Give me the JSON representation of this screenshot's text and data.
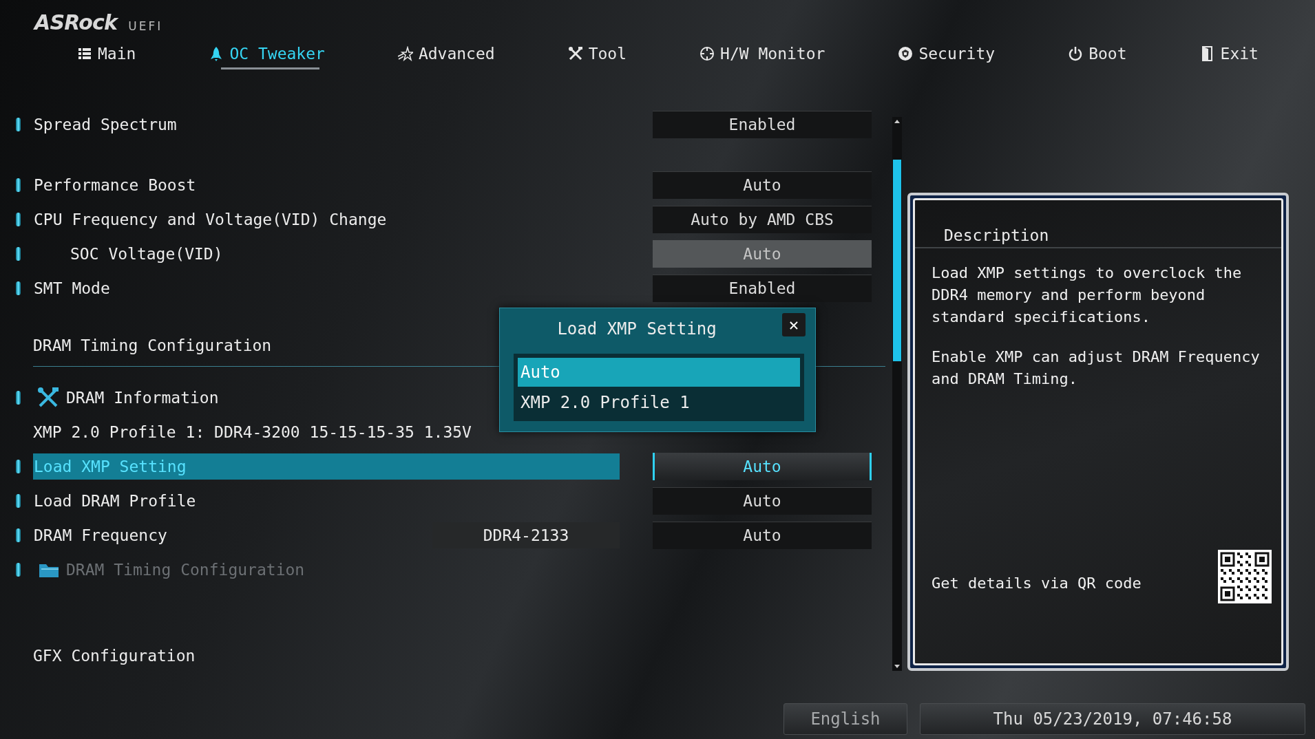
{
  "header": {
    "logo": "ASRock",
    "subtitle": "UEFI"
  },
  "tabs": [
    {
      "label": "Main",
      "selected": false
    },
    {
      "label": "OC Tweaker",
      "selected": true
    },
    {
      "label": "Advanced",
      "selected": false
    },
    {
      "label": "Tool",
      "selected": false
    },
    {
      "label": "H/W Monitor",
      "selected": false
    },
    {
      "label": "Security",
      "selected": false
    },
    {
      "label": "Boot",
      "selected": false
    },
    {
      "label": "Exit",
      "selected": false
    }
  ],
  "settings": [
    {
      "kind": "setting",
      "label": "Spread Spectrum",
      "value": "Enabled",
      "selected": false,
      "disabled": false
    },
    {
      "kind": "setting",
      "label": "Performance Boost",
      "value": "Auto",
      "selected": false,
      "disabled": false
    },
    {
      "kind": "setting",
      "label": "CPU Frequency and Voltage(VID) Change",
      "value": "Auto by AMD CBS",
      "selected": false,
      "disabled": false,
      "children": [
        {
          "kind": "setting",
          "label": "SOC Voltage(VID)",
          "value": "Auto",
          "selected": false,
          "disabled": true
        }
      ]
    },
    {
      "kind": "setting",
      "label": "SMT Mode",
      "value": "Enabled",
      "selected": false,
      "disabled": false
    },
    {
      "kind": "header",
      "label": "DRAM Timing Configuration",
      "selected": false,
      "disabled": false
    },
    {
      "kind": "info",
      "label": "DRAM Information",
      "selected": false,
      "disabled": false
    },
    {
      "kind": "text",
      "label": "XMP 2.0 Profile 1: DDR4-3200 15-15-15-35 1.35V",
      "selected": false,
      "disabled": false
    },
    {
      "kind": "setting",
      "label": "Load XMP Setting",
      "value": "Auto",
      "selected": true,
      "disabled": false
    },
    {
      "kind": "setting",
      "label": "Load DRAM Profile",
      "value": "Auto",
      "selected": false,
      "disabled": false
    },
    {
      "kind": "setting",
      "label": "DRAM Frequency",
      "current": "DDR4-2133",
      "value": "Auto",
      "selected": false,
      "disabled": false
    },
    {
      "kind": "folder",
      "label": "DRAM Timing Configuration",
      "selected": false,
      "disabled": true
    },
    {
      "kind": "header",
      "label": "GFX Configuration",
      "selected": false,
      "disabled": false
    }
  ],
  "popup": {
    "title": "Load XMP Setting",
    "close": "✕",
    "options": [
      {
        "label": "Auto",
        "selected": true
      },
      {
        "label": "XMP 2.0 Profile 1",
        "selected": false
      }
    ]
  },
  "description": {
    "title": "Description",
    "paragraphs": [
      "Load XMP settings to overclock the DDR4 memory and perform beyond standard specifications.",
      "Enable XMP can adjust DRAM Frequency and DRAM Timing."
    ],
    "qr_caption": "Get details via QR code"
  },
  "status_bar": {
    "language": "English",
    "datetime": "Thu 05/23/2019, 07:46:58"
  }
}
